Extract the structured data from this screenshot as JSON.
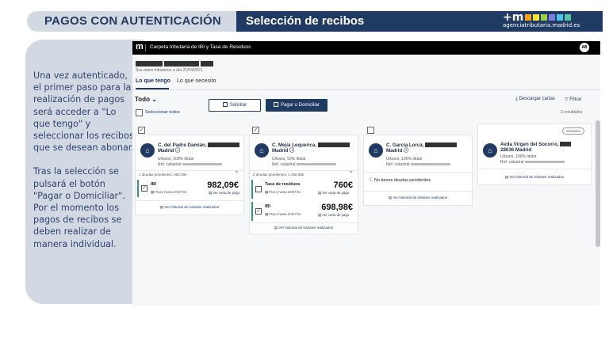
{
  "header": {
    "title": "PAGOS CON AUTENTICACIÓN",
    "subtitle": "Selección de recibos",
    "brand_mark": "+m",
    "brand_url": "agenciatributaria.madrid.es",
    "brand_colors": [
      "#f2a31b",
      "#f6e33b",
      "#9ad04c",
      "#7a7fe0",
      "#4fc3e8",
      "#55c4a8"
    ]
  },
  "left_panel": {
    "paragraph1": "Una vez autenticado, el primer paso para la realización de pagos será acceder a \"Lo que tengo\" y seleccionar los recibos que se desean abonar.",
    "paragraph2": "Tras la selección se pulsará el botón \"Pagar o Domiciliar\". Por el momento los pagos de recibos se deben realizar de manera individual."
  },
  "app": {
    "logo": "m",
    "title": "Carpeta tributaria de IBI y Tasa de Residuos",
    "avatar": "AB",
    "subinfo": "Sus datos tributarios a día 21/04/2021",
    "tabs": [
      "Lo que tengo",
      "Lo que necesito"
    ],
    "filter_label": "Todo",
    "select_all": "Seleccionar todos",
    "solicitar": "Solicitar",
    "pagar": "Pagar o Domiciliar",
    "descargar": "Descargar cartas",
    "filtrar": "Filtrar",
    "resultados": "2 resultados",
    "cards": [
      {
        "address": "C. del Padre Damián,",
        "city": "Madrid",
        "use": "Urbano, 100% titular",
        "ref": "Ref. catastral",
        "deudas": "1 deudas pendientes: 982,09€",
        "items": [
          {
            "name": "IBI",
            "plazo": "Plazo hasta 20/07/21",
            "amount": "982,09€",
            "carta": "Ver carta de pago"
          }
        ],
        "historial": "Ver historial de trámites realizados"
      },
      {
        "address": "C. Mejía Lequerica,",
        "city": "Madrid",
        "use": "Urbano, 50% titular",
        "ref": "Ref. catastral",
        "deudas": "2 deudas pendientes: 1.458,98€",
        "items": [
          {
            "name": "Tasa de residuos",
            "plazo": "Plazo hasta 20/07/21",
            "amount": "760€",
            "carta": "Ver carta de pago"
          },
          {
            "name": "IBI",
            "plazo": "Plazo hasta 20/07/21",
            "amount": "698,98€",
            "carta": "Ver carta de pago"
          }
        ],
        "historial": "Ver historial de trámites realizados"
      },
      {
        "address": "C. García Lorca,",
        "city": "Madrid",
        "use": "Urbano, 100% titular",
        "ref": "Ref. catastral",
        "no_deudas": "No tienes deudas pendientes",
        "historial": "Ver historial de trámites realizados"
      },
      {
        "badge": "VENDIDO",
        "address": "Avda Virgen del Socorro,",
        "city": "28036 Madrid",
        "use": "Urbano, 100% titular",
        "ref": "Ref. catastral",
        "historial": "Ver historial de trámites realizados"
      }
    ]
  }
}
